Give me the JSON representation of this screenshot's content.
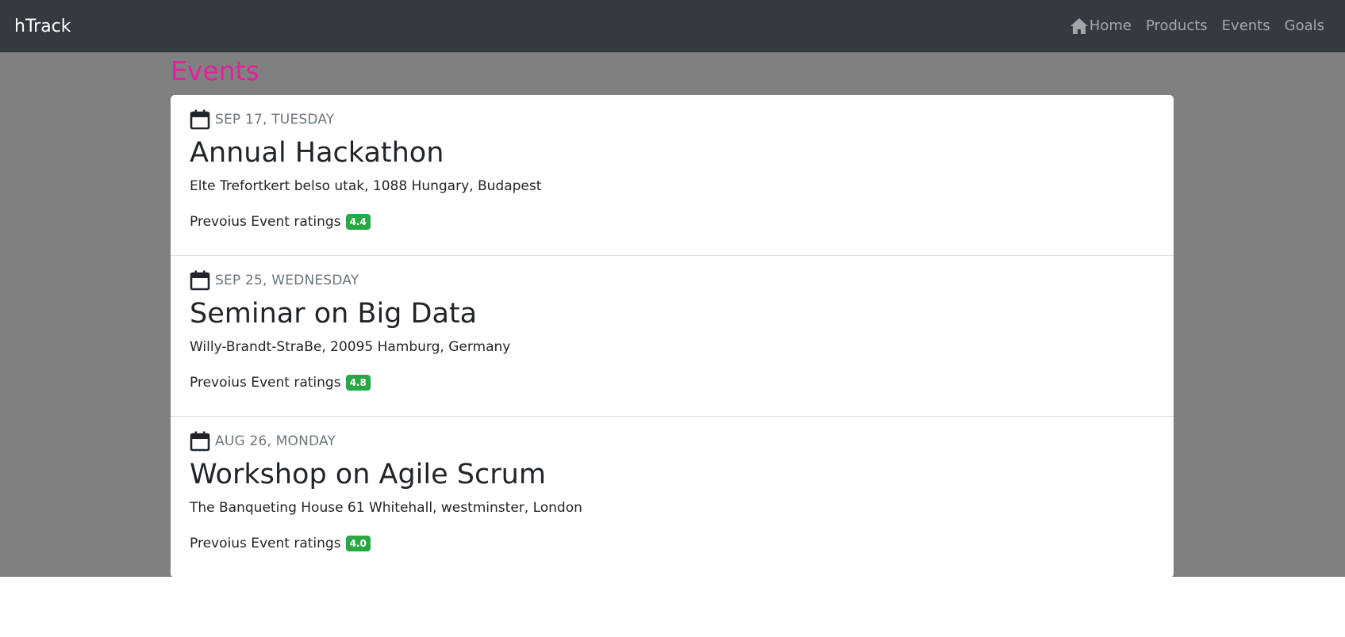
{
  "navbar": {
    "brand": "hTrack",
    "links": [
      {
        "label": "Home",
        "icon": "home-icon"
      },
      {
        "label": "Products"
      },
      {
        "label": "Events"
      },
      {
        "label": "Goals"
      }
    ]
  },
  "page": {
    "title": "Events"
  },
  "events": [
    {
      "date": "SEP 17, TUESDAY",
      "title": "Annual Hackathon",
      "address": "Elte Trefortkert belso utak, 1088 Hungary, Budapest",
      "rating_label": "Prevoius Event ratings",
      "rating": "4.4"
    },
    {
      "date": "SEP 25, WEDNESDAY",
      "title": "Seminar on Big Data",
      "address": "Willy-Brandt-StraBe, 20095 Hamburg, Germany",
      "rating_label": "Prevoius Event ratings",
      "rating": "4.8"
    },
    {
      "date": "AUG 26, MONDAY",
      "title": "Workshop on Agile Scrum",
      "address": "The Banqueting House 61 Whitehall, westminster, London",
      "rating_label": "Prevoius Event ratings",
      "rating": "4.0"
    }
  ],
  "colors": {
    "navbar_bg": "#343a40",
    "backdrop": "#808080",
    "title_accent": "#e61ea0",
    "badge_bg": "#28a745"
  }
}
